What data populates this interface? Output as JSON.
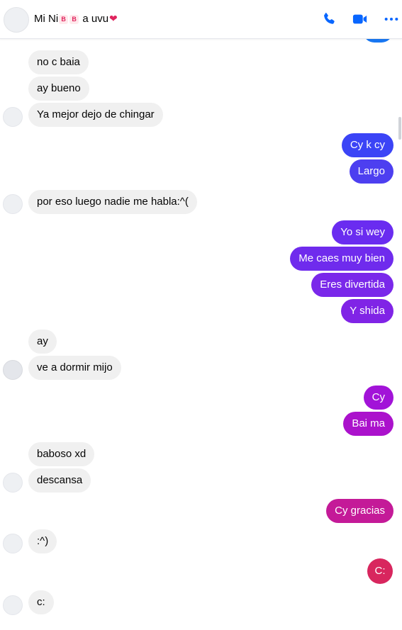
{
  "header": {
    "title_prefix": "Mi Ni",
    "badge_1": "B",
    "badge_2": "B",
    "title_suffix": "a uvu",
    "heart": "❤",
    "icons": [
      "phone-icon",
      "video-camera-icon",
      "more-options-icon"
    ],
    "accent_color": "#0866ff"
  },
  "messages": [
    {
      "side": "in",
      "text": "no c baia"
    },
    {
      "side": "in",
      "text": "ay bueno"
    },
    {
      "side": "in",
      "text": "Ya mejor dejo de chingar"
    },
    {
      "side": "out",
      "text": "Cy k cy",
      "color": "#3b44f6"
    },
    {
      "side": "out",
      "text": "Largo",
      "color": "#4d3ff0"
    },
    {
      "side": "in",
      "text": "por eso luego nadie me habla:^("
    },
    {
      "side": "out",
      "text": "Yo si wey",
      "color": "#6a2cf0"
    },
    {
      "side": "out",
      "text": "Me caes muy bien",
      "color": "#6f2bed"
    },
    {
      "side": "out",
      "text": "Eres divertida",
      "color": "#7a28ea"
    },
    {
      "side": "out",
      "text": "Y shida",
      "color": "#8024e6"
    },
    {
      "side": "in",
      "text": "ay"
    },
    {
      "side": "in",
      "text": "ve a dormir mijo"
    },
    {
      "side": "out",
      "text": "Cy",
      "color": "#a213d8"
    },
    {
      "side": "out",
      "text": "Bai ma",
      "color": "#ab12cc"
    },
    {
      "side": "in",
      "text": "baboso xd"
    },
    {
      "side": "in",
      "text": "descansa"
    },
    {
      "side": "out",
      "text": "Cy gracias",
      "color": "#c41a98"
    },
    {
      "side": "in",
      "text": ":^)"
    },
    {
      "side": "out",
      "text": "C:",
      "color": "#d8265e"
    },
    {
      "side": "in",
      "text": "c:"
    }
  ]
}
